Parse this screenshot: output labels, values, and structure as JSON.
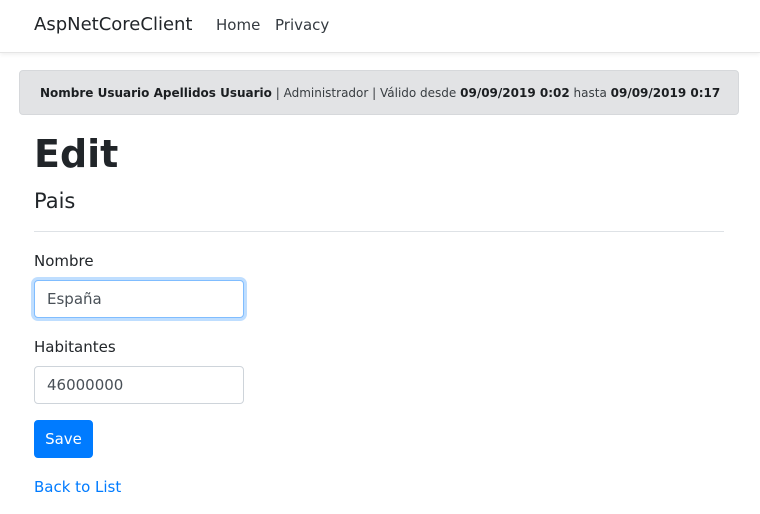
{
  "navbar": {
    "brand": "AspNetCoreClient",
    "links": [
      "Home",
      "Privacy"
    ]
  },
  "session": {
    "user_name": "Nombre Usuario Apellidos Usuario",
    "sep1": " | ",
    "role": "Administrador",
    "sep2": " | ",
    "valid_from_label": "Válido desde ",
    "valid_from": "09/09/2019 0:02",
    "until_label": " hasta ",
    "valid_until": "09/09/2019 0:17"
  },
  "page": {
    "title": "Edit",
    "entity": "Pais"
  },
  "form": {
    "nombre_label": "Nombre",
    "nombre_value": "España",
    "habitantes_label": "Habitantes",
    "habitantes_value": "46000000",
    "save_label": "Save",
    "back_label": "Back to List"
  },
  "colors": {
    "primary": "#007bff",
    "alert_bg": "#e2e3e5"
  }
}
